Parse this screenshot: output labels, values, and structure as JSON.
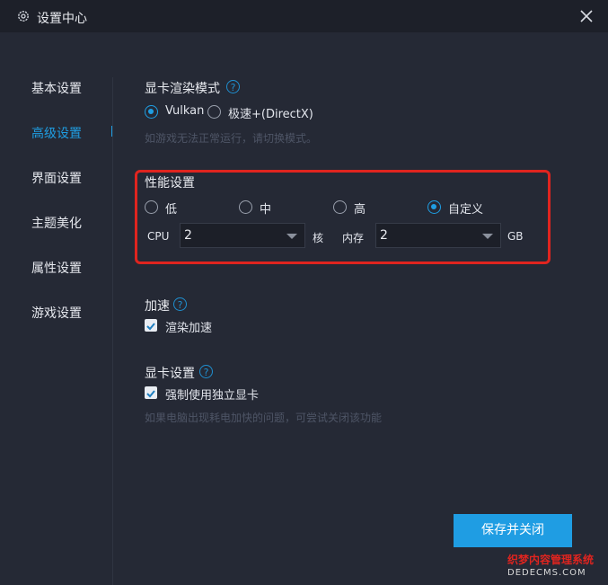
{
  "window": {
    "title": "设置中心",
    "close_icon": "close-icon"
  },
  "sidebar": {
    "items": [
      {
        "label": "基本设置",
        "active": false
      },
      {
        "label": "高级设置",
        "active": true
      },
      {
        "label": "界面设置",
        "active": false
      },
      {
        "label": "主题美化",
        "active": false
      },
      {
        "label": "属性设置",
        "active": false
      },
      {
        "label": "游戏设置",
        "active": false
      }
    ]
  },
  "render_mode": {
    "title": "显卡渲染模式",
    "options": [
      {
        "label": "Vulkan",
        "selected": true
      },
      {
        "label": "极速+(DirectX)",
        "selected": false
      }
    ],
    "hint": "如游戏无法正常运行，请切换模式。"
  },
  "performance": {
    "title": "性能设置",
    "options": [
      {
        "label": "低",
        "selected": false
      },
      {
        "label": "中",
        "selected": false
      },
      {
        "label": "高",
        "selected": false
      },
      {
        "label": "自定义",
        "selected": true
      }
    ],
    "cpu_label": "CPU",
    "cpu_value": "2",
    "cpu_unit": "核",
    "memory_label": "内存",
    "memory_value": "2",
    "memory_unit": "GB"
  },
  "acceleration": {
    "title": "加速",
    "checkbox_label": "渲染加速",
    "checked": true
  },
  "gpu": {
    "title": "显卡设置",
    "checkbox_label": "强制使用独立显卡",
    "checked": true,
    "hint": "如果电脑出现耗电加快的问题，可尝试关闭该功能"
  },
  "save_button": {
    "label": "保存并关闭"
  },
  "watermark": {
    "top": "织梦内容管理系统",
    "bottom": "DEDECMS.COM"
  },
  "colors": {
    "accent": "#1f9ee3",
    "highlight_border": "#e0241f",
    "background": "#252935",
    "titlebar": "#1d2029"
  }
}
